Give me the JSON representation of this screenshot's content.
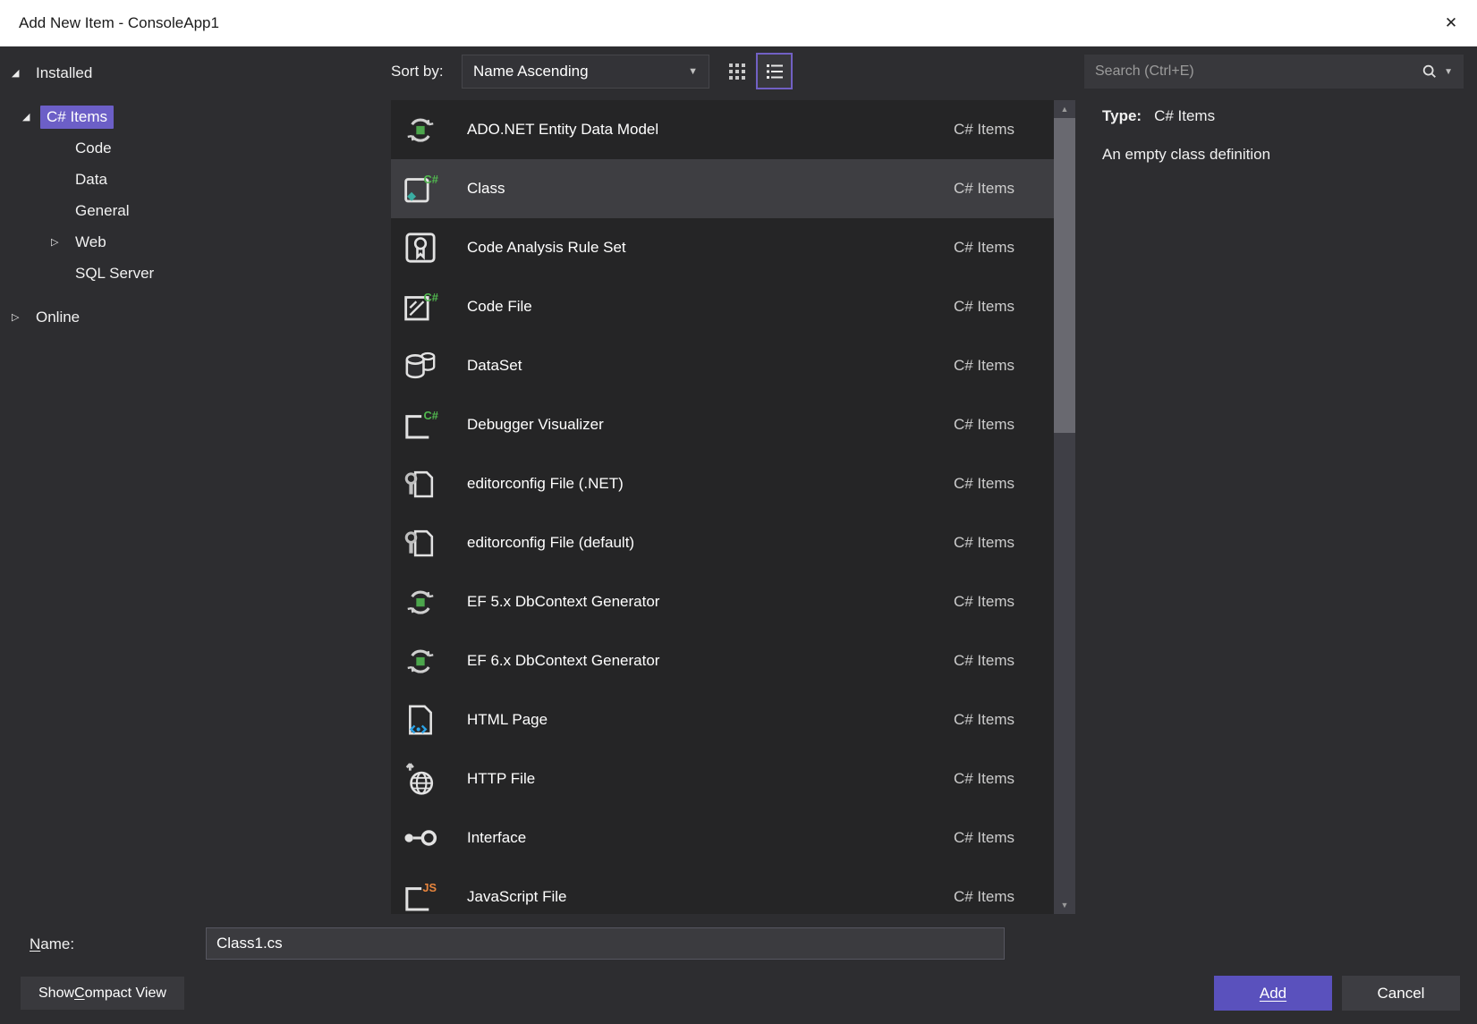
{
  "window": {
    "title": "Add New Item - ConsoleApp1"
  },
  "icons": {
    "close": "✕",
    "caret": "▼",
    "expanded": "◢",
    "collapsed": "▷",
    "scroll_up": "▲",
    "scroll_down": "▼"
  },
  "colors": {
    "accent_selection": "#6c5fc7",
    "add_button": "#5a51bd",
    "selected_row": "#3e3e42",
    "titlebar_bg": "#ffffff",
    "dialog_bg": "#2d2d30",
    "list_bg": "#252526"
  },
  "tree": {
    "items": [
      {
        "label": "Installed",
        "level": 0,
        "expanded": true
      },
      {
        "label": "C# Items",
        "level": 1,
        "expanded": true,
        "selected": true,
        "gap_before": true
      },
      {
        "label": "Code",
        "level": 2
      },
      {
        "label": "Data",
        "level": 2
      },
      {
        "label": "General",
        "level": 2
      },
      {
        "label": "Web",
        "level": 2,
        "expanded": false
      },
      {
        "label": "SQL Server",
        "level": 2
      },
      {
        "label": "Online",
        "level": 0,
        "expanded": false,
        "gap_before": true
      }
    ]
  },
  "toolbar": {
    "sort_label": "Sort by:",
    "sort_value": "Name Ascending"
  },
  "search": {
    "placeholder": "Search (Ctrl+E)"
  },
  "details": {
    "type_label": "Type:",
    "type_value": "C# Items",
    "description": "An empty class definition"
  },
  "list": {
    "items": [
      {
        "name": "ADO.NET Entity Data Model",
        "category": "C# Items",
        "icon": "entity-model-icon"
      },
      {
        "name": "Class",
        "category": "C# Items",
        "icon": "class-icon",
        "selected": true
      },
      {
        "name": "Code Analysis Rule Set",
        "category": "C# Items",
        "icon": "rule-set-icon"
      },
      {
        "name": "Code File",
        "category": "C# Items",
        "icon": "code-file-icon"
      },
      {
        "name": "DataSet",
        "category": "C# Items",
        "icon": "dataset-icon"
      },
      {
        "name": "Debugger Visualizer",
        "category": "C# Items",
        "icon": "debugger-visualizer-icon"
      },
      {
        "name": "editorconfig File (.NET)",
        "category": "C# Items",
        "icon": "editorconfig-icon"
      },
      {
        "name": "editorconfig File (default)",
        "category": "C# Items",
        "icon": "editorconfig-icon"
      },
      {
        "name": "EF 5.x DbContext Generator",
        "category": "C# Items",
        "icon": "entity-model-icon"
      },
      {
        "name": "EF 6.x DbContext Generator",
        "category": "C# Items",
        "icon": "entity-model-icon"
      },
      {
        "name": "HTML Page",
        "category": "C# Items",
        "icon": "html-page-icon"
      },
      {
        "name": "HTTP File",
        "category": "C# Items",
        "icon": "http-file-icon"
      },
      {
        "name": "Interface",
        "category": "C# Items",
        "icon": "interface-icon"
      },
      {
        "name": "JavaScript File",
        "category": "C# Items",
        "icon": "javascript-file-icon"
      }
    ]
  },
  "footer": {
    "name_label": {
      "mn": "N",
      "rest": "ame:"
    },
    "name_value": "Class1.cs",
    "compact_button": {
      "pre": "Show ",
      "mn": "C",
      "rest": "ompact View"
    },
    "add_button": "Add",
    "cancel_button": "Cancel"
  }
}
